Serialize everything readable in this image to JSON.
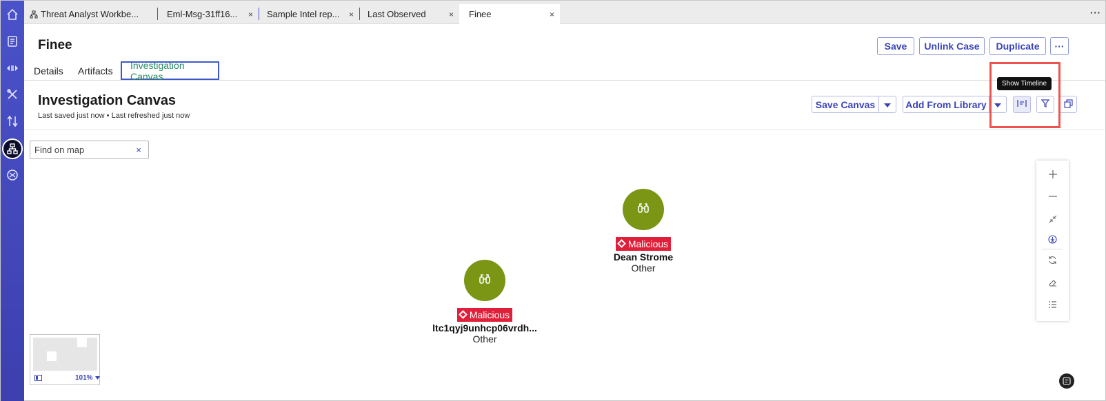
{
  "tabs": [
    {
      "label": "Threat Analyst Workbe...",
      "icon": "workbench-icon"
    },
    {
      "label": "Eml-Msg-31ff16..."
    },
    {
      "label": "Sample Intel rep..."
    },
    {
      "label": "Last Observed"
    },
    {
      "label": "Finee",
      "active": true
    }
  ],
  "tab_close_glyph": "×",
  "tab_menu_glyph": "···",
  "header": {
    "title": "Finee",
    "buttons": {
      "save": "Save",
      "unlink": "Unlink Case",
      "duplicate": "Duplicate",
      "more": "···"
    }
  },
  "subtabs": {
    "details": "Details",
    "artifacts": "Artifacts",
    "canvas": "Investigation Canvas"
  },
  "canvas": {
    "title": "Investigation Canvas",
    "status": "Last saved just now • Last refreshed just now",
    "save_canvas": "Save Canvas",
    "add_from_library": "Add From Library",
    "tooltip": "Show Timeline"
  },
  "search": {
    "placeholder": "Find on map",
    "clear": "×"
  },
  "nodes": [
    {
      "badge": "Malicious",
      "name": "Dean Strome",
      "type": "Other"
    },
    {
      "badge": "Malicious",
      "name": "ltc1qyj9unhcp06vrdh...",
      "type": "Other"
    }
  ],
  "minimap": {
    "zoom": "101%"
  },
  "colors": {
    "nav": "#4a52c9",
    "accent": "#3a44b8",
    "node": "#7a9614",
    "malicious": "#e0203a",
    "highlight": "#ef5350"
  }
}
